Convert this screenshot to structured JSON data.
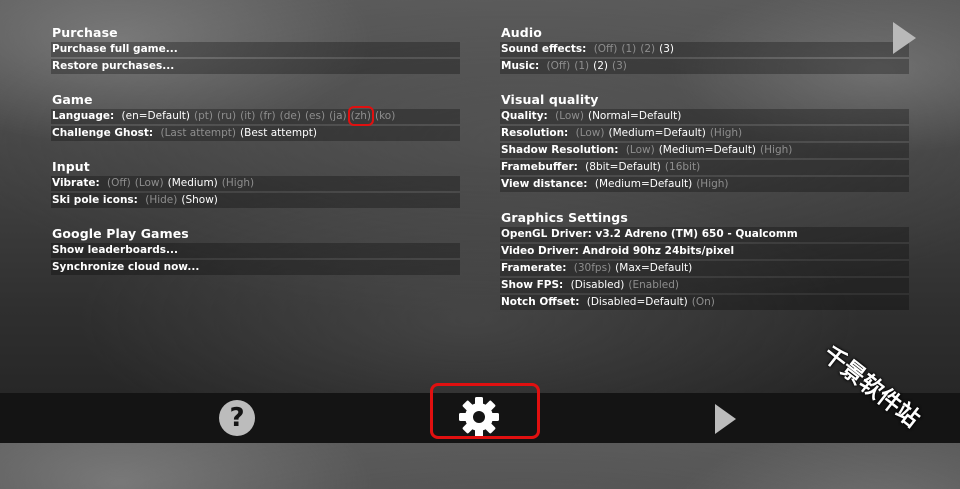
{
  "left": {
    "purchase": {
      "title": "Purchase",
      "rows": [
        {
          "label": "Purchase full game..."
        },
        {
          "label": "Restore purchases..."
        }
      ]
    },
    "game": {
      "title": "Game",
      "language": {
        "label": "Language:",
        "options": [
          "(en=Default)",
          "(pt)",
          "(ru)",
          "(it)",
          "(fr)",
          "(de)",
          "(es)",
          "(ja)",
          "(zh)",
          "(ko)"
        ],
        "selected_index": 0,
        "highlighted_index": 8
      },
      "ghost": {
        "label": "Challenge Ghost:",
        "options": [
          "(Last attempt)",
          "(Best attempt)"
        ],
        "selected_index": 1
      }
    },
    "input": {
      "title": "Input",
      "vibrate": {
        "label": "Vibrate:",
        "options": [
          "(Off)",
          "(Low)",
          "(Medium)",
          "(High)"
        ],
        "selected_index": 2
      },
      "ski_pole": {
        "label": "Ski pole icons:",
        "options": [
          "(Hide)",
          "(Show)"
        ],
        "selected_index": 1
      }
    },
    "google": {
      "title": "Google Play Games",
      "rows": [
        {
          "label": "Show leaderboards..."
        },
        {
          "label": "Synchronize cloud now..."
        }
      ]
    }
  },
  "right": {
    "audio": {
      "title": "Audio",
      "sound": {
        "label": "Sound effects:",
        "options": [
          "(Off)",
          "(1)",
          "(2)",
          "(3)"
        ],
        "selected_index": 3
      },
      "music": {
        "label": "Music:",
        "options": [
          "(Off)",
          "(1)",
          "(2)",
          "(3)"
        ],
        "selected_index": 2
      }
    },
    "visual": {
      "title": "Visual quality",
      "quality": {
        "label": "Quality:",
        "options": [
          "(Low)",
          "(Normal=Default)"
        ],
        "selected_index": 1
      },
      "resolution": {
        "label": "Resolution:",
        "options": [
          "(Low)",
          "(Medium=Default)",
          "(High)"
        ],
        "selected_index": 1
      },
      "shadow": {
        "label": "Shadow Resolution:",
        "options": [
          "(Low)",
          "(Medium=Default)",
          "(High)"
        ],
        "selected_index": 1
      },
      "framebuffer": {
        "label": "Framebuffer:",
        "options": [
          "(8bit=Default)",
          "(16bit)"
        ],
        "selected_index": 0
      },
      "view": {
        "label": "View distance:",
        "options": [
          "(Medium=Default)",
          "(High)"
        ],
        "selected_index": 0
      }
    },
    "graphics": {
      "title": "Graphics Settings",
      "opengl": "OpenGL Driver: v3.2 Adreno (TM) 650 - Qualcomm",
      "video": "Video Driver: Android 90hz 24bits/pixel",
      "framerate": {
        "label": "Framerate:",
        "options": [
          "(30fps)",
          "(Max=Default)"
        ],
        "selected_index": 1
      },
      "fps": {
        "label": "Show FPS:",
        "options": [
          "(Disabled)",
          "(Enabled)"
        ],
        "selected_index": 0
      },
      "notch": {
        "label": "Notch Offset:",
        "options": [
          "(Disabled=Default)",
          "(On)"
        ],
        "selected_index": 0
      }
    }
  },
  "bottom": {
    "help_glyph": "?",
    "icons": [
      "help-icon",
      "gear-icon",
      "play-icon"
    ]
  },
  "top_right_icon": "play-icon",
  "watermark": "千景软件站",
  "colors": {
    "selected": "#ffffff",
    "unselected": "#8e8e8e",
    "highlight": "#e01010"
  }
}
